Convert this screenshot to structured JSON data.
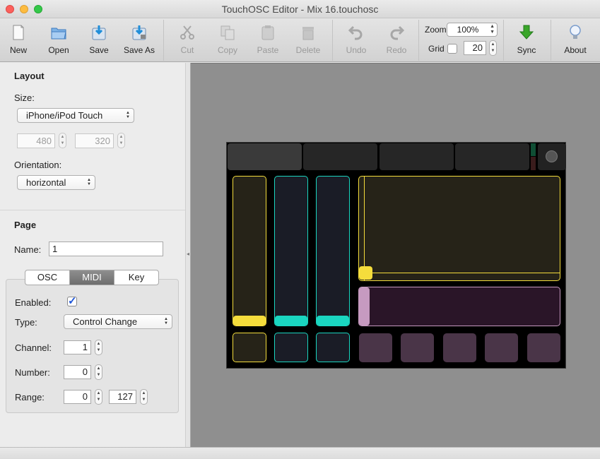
{
  "window": {
    "title": "TouchOSC Editor - Mix 16.touchosc"
  },
  "toolbar": {
    "new": "New",
    "open": "Open",
    "save": "Save",
    "save_as": "Save As",
    "cut": "Cut",
    "copy": "Copy",
    "paste": "Paste",
    "delete": "Delete",
    "undo": "Undo",
    "redo": "Redo",
    "zoom_label": "Zoom",
    "zoom_value": "100%",
    "grid_label": "Grid",
    "grid_value": "20",
    "sync": "Sync",
    "about": "About"
  },
  "layout": {
    "heading": "Layout",
    "size_label": "Size:",
    "size_value": "iPhone/iPod Touch",
    "width": "480",
    "height": "320",
    "orientation_label": "Orientation:",
    "orientation_value": "horizontal"
  },
  "page": {
    "heading": "Page",
    "name_label": "Name:",
    "name_value": "1",
    "tabs": [
      "OSC",
      "MIDI",
      "Key"
    ],
    "active_tab": "MIDI",
    "enabled_label": "Enabled:",
    "enabled": true,
    "type_label": "Type:",
    "type_value": "Control Change",
    "channel_label": "Channel:",
    "channel_value": "1",
    "number_label": "Number:",
    "number_value": "0",
    "range_label": "Range:",
    "range_min": "0",
    "range_max": "127"
  },
  "colors": {
    "yellow": "#f5dd3c",
    "cyan": "#1ad6c0",
    "pink": "#c69ac0",
    "purple_btn": "#4a3548",
    "page_tab": "#262626",
    "sync_green": "#3aa62a"
  },
  "icons": {
    "new": "new-document-icon",
    "open": "open-folder-icon",
    "save": "save-disk-icon",
    "save_as": "save-as-icon",
    "cut": "scissors-icon",
    "copy": "copy-icon",
    "paste": "clipboard-icon",
    "delete": "trash-icon",
    "undo": "undo-arrow-icon",
    "redo": "redo-arrow-icon",
    "sync": "sync-down-arrow-icon",
    "about": "lightbulb-icon"
  }
}
